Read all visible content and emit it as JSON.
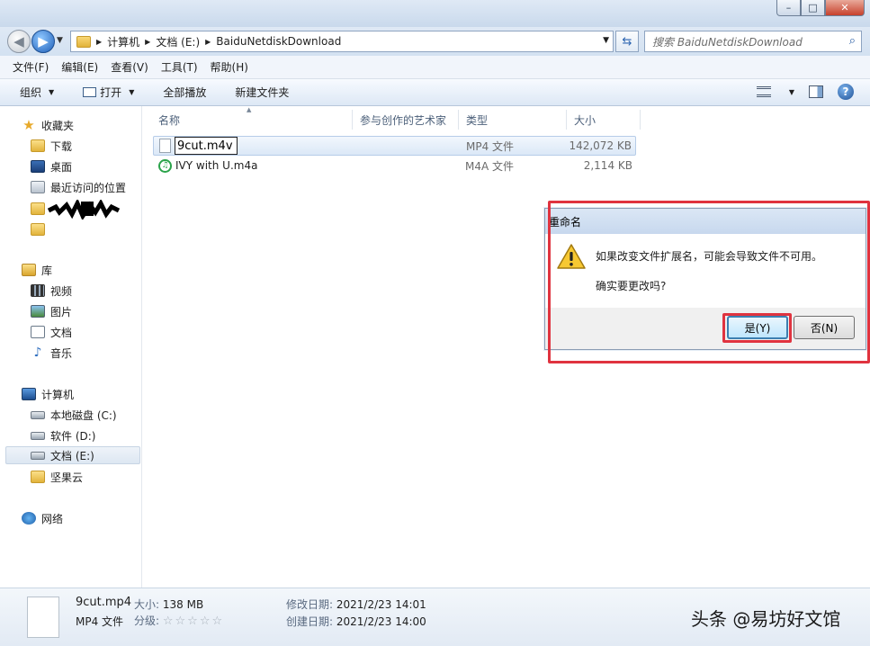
{
  "window": {
    "min": "–",
    "max": "□",
    "close": "✕"
  },
  "address": {
    "crumbs": [
      "计算机",
      "文档 (E:)",
      "BaiduNetdiskDownload"
    ],
    "search_placeholder": "搜索 BaiduNetdiskDownload"
  },
  "menu": [
    "文件(F)",
    "编辑(E)",
    "查看(V)",
    "工具(T)",
    "帮助(H)"
  ],
  "commands": {
    "organize": "组织",
    "open": "打开",
    "play_all": "全部播放",
    "new_folder": "新建文件夹",
    "help": "?"
  },
  "nav": {
    "favorites": "收藏夹",
    "fav_items": [
      "下载",
      "桌面",
      "最近访问的位置"
    ],
    "library": "库",
    "lib_items": [
      "视频",
      "图片",
      "文档",
      "音乐"
    ],
    "computer": "计算机",
    "drives": [
      "本地磁盘 (C:)",
      "软件 (D:)",
      "文档 (E:)",
      "坚果云"
    ],
    "network": "网络"
  },
  "columns": {
    "name": "名称",
    "artist": "参与创作的艺术家",
    "type": "类型",
    "size": "大小"
  },
  "files": [
    {
      "name": "9cut.m4v",
      "type": "MP4 文件",
      "size": "142,072 KB"
    },
    {
      "name": "IVY with U.m4a",
      "type": "M4A 文件",
      "size": "2,114 KB"
    }
  ],
  "dialog": {
    "title": "重命名",
    "message": "如果改变文件扩展名，可能会导致文件不可用。",
    "question": "确实要更改吗?",
    "yes": "是(Y)",
    "no": "否(N)"
  },
  "details": {
    "filename": "9cut.mp4",
    "size_label": "大小:",
    "size": "138 MB",
    "filetype": "MP4 文件",
    "rating_label": "分级:",
    "rating_stars": "☆☆☆☆☆",
    "modified_label": "修改日期:",
    "modified": "2021/2/23 14:01",
    "created_label": "创建日期:",
    "created": "2021/2/23 14:00"
  },
  "watermark": "头条 @易坊好文馆",
  "colors": {
    "highlight": "#e0333f",
    "accent": "#3c7fb1"
  }
}
